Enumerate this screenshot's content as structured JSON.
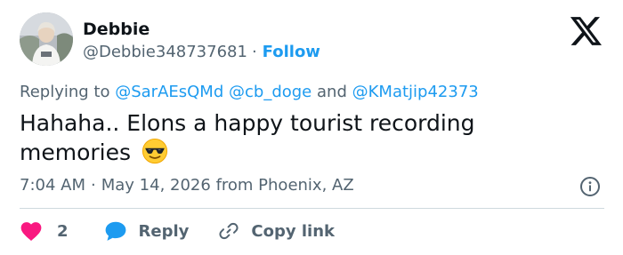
{
  "author": {
    "display_name": "Debbie",
    "handle": "@Debbie348737681",
    "separator": "·",
    "follow_label": "Follow",
    "avatar_icon": "profile-photo"
  },
  "brand": {
    "logo_icon": "x-logo"
  },
  "reply_context": {
    "prefix": "Replying to",
    "mention_1": "@SarAEsQMd",
    "mention_2": "@cb_doge",
    "conjunction": "and",
    "mention_3": "@KMatjip42373"
  },
  "tweet": {
    "text": "Hahaha..  Elons a happy tourist recording memories",
    "emoji_icon": "smiling-face-with-sunglasses-emoji"
  },
  "meta": {
    "time": "7:04 AM",
    "separator": "·",
    "date": "May 14, 2026",
    "location": "from Phoenix, AZ",
    "info_icon": "info-icon"
  },
  "actions": {
    "like_count": "2",
    "reply_label": "Reply",
    "copy_link_label": "Copy link",
    "like_icon": "heart-icon",
    "reply_icon": "speech-bubble-icon",
    "copy_icon": "link-icon"
  },
  "colors": {
    "accent": "#1d9bf0",
    "like": "#f91880",
    "text_primary": "#0f1419",
    "text_secondary": "#536471",
    "divider": "#cfd9de"
  }
}
